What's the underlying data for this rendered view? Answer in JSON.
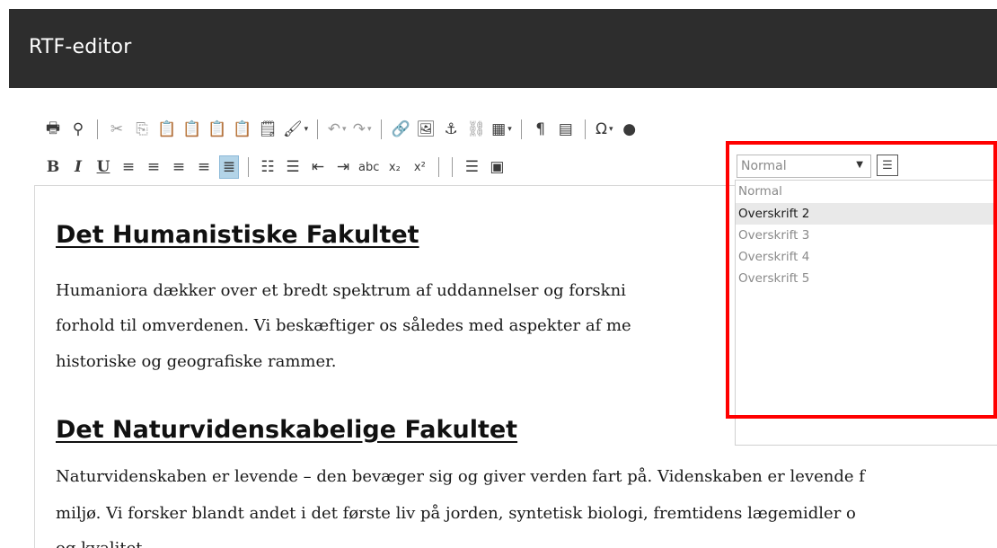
{
  "window": {
    "title": "RTF-editor"
  },
  "toolbar": {
    "row1": [
      {
        "name": "print-icon",
        "glyph": "🖶"
      },
      {
        "name": "find-icon",
        "glyph": "⚲"
      },
      {
        "sep": true
      },
      {
        "name": "cut-icon",
        "glyph": "✂",
        "grey": true
      },
      {
        "name": "copy-icon",
        "glyph": "⎘",
        "grey": true
      },
      {
        "name": "paste-icon",
        "glyph": "📋"
      },
      {
        "name": "paste-text-icon",
        "glyph": "📋"
      },
      {
        "name": "paste-word-icon",
        "glyph": "📋"
      },
      {
        "name": "clipboard-icon",
        "glyph": "📋"
      },
      {
        "name": "clipboard-outline-icon",
        "glyph": "🗒"
      },
      {
        "name": "clean-format-icon",
        "glyph": "🖌",
        "dropdown": true
      },
      {
        "sep": true
      },
      {
        "name": "undo-icon",
        "glyph": "↶",
        "grey": true,
        "dropdown": true
      },
      {
        "name": "redo-icon",
        "glyph": "↷",
        "grey": true,
        "dropdown": true
      },
      {
        "sep": true
      },
      {
        "name": "link-icon",
        "glyph": "🔗"
      },
      {
        "name": "image-icon",
        "glyph": "🖼"
      },
      {
        "name": "anchor-icon",
        "glyph": "⚓"
      },
      {
        "name": "unlink-icon",
        "glyph": "⛓",
        "grey": true
      },
      {
        "name": "table-icon",
        "glyph": "▦",
        "dropdown": true
      },
      {
        "sep": true
      },
      {
        "name": "paragraph-icon",
        "glyph": "¶"
      },
      {
        "name": "template-icon",
        "glyph": "▤"
      },
      {
        "sep": true
      },
      {
        "name": "special-char-icon",
        "glyph": "Ω",
        "dropdown": true
      },
      {
        "name": "media-icon",
        "glyph": "●"
      }
    ],
    "row2": [
      {
        "name": "bold-icon",
        "glyph": "B",
        "text": true
      },
      {
        "name": "italic-icon",
        "glyph": "I",
        "text": true,
        "italic": true
      },
      {
        "name": "underline-icon",
        "glyph": "U",
        "text": true,
        "underline": true
      },
      {
        "name": "align-left-icon",
        "glyph": "≡"
      },
      {
        "name": "align-center-icon",
        "glyph": "≡"
      },
      {
        "name": "align-right-icon",
        "glyph": "≡"
      },
      {
        "name": "align-justify-icon",
        "glyph": "≡"
      },
      {
        "name": "align-full-icon",
        "glyph": "≣",
        "active": true
      },
      {
        "sep": true
      },
      {
        "name": "numbered-list-icon",
        "glyph": "☷"
      },
      {
        "name": "bullet-list-icon",
        "glyph": "☰"
      },
      {
        "name": "outdent-icon",
        "glyph": "⇤"
      },
      {
        "name": "indent-icon",
        "glyph": "⇥"
      },
      {
        "name": "strikethrough-icon",
        "glyph": "abc",
        "small": true
      },
      {
        "name": "subscript-icon",
        "glyph": "x₂",
        "small": true
      },
      {
        "name": "superscript-icon",
        "glyph": "x²",
        "small": true
      },
      {
        "sep": true
      },
      {
        "sep": true
      },
      {
        "name": "horizontal-rule-icon",
        "glyph": "☰"
      },
      {
        "name": "frame-icon",
        "glyph": "▣"
      }
    ]
  },
  "format_select": {
    "value": "Normal",
    "options": [
      "Normal",
      "Overskrift 2",
      "Overskrift 3",
      "Overskrift 4",
      "Overskrift 5"
    ],
    "selected_index": 1
  },
  "content": {
    "heading1": "Det Humanistiske Fakultet",
    "para1": [
      "Humaniora dækker over et bredt spektrum af uddannelser og forskni",
      "forhold til omverdenen. Vi beskæftiger os således med aspekter af me",
      "historiske og geografiske rammer."
    ],
    "heading2": "Det Naturvidenskabelige Fakultet",
    "para2": [
      "Naturvidenskaben er levende – den bevæger sig og giver verden fart på. Videnskaben er levende f",
      "miljø. Vi forsker blandt andet i det første liv på jorden, syntetisk biologi, fremtidens lægemidler o",
      "og kvalitet."
    ]
  },
  "colors": {
    "titlebar": "#2d2d2d",
    "highlight": "#ff0000",
    "active_button": "#b3d4e8"
  }
}
